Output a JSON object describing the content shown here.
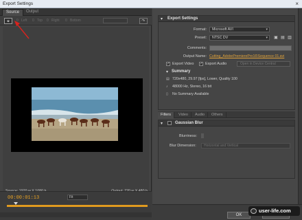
{
  "window": {
    "title": "Export Settings",
    "close_glyph": "×"
  },
  "left": {
    "tabs": [
      "Source",
      "Output"
    ],
    "toolbar": {
      "crop_glyph": "⧈",
      "fields": [
        "Left",
        "Top",
        "Right",
        "Bottom"
      ],
      "zero": "0",
      "menu_glyph": "↷"
    },
    "source_info": "Source: 1920 w X 1080 h",
    "output_info": "Output: 720 w X 480 h",
    "timecode": "00:00:01:13",
    "fit": "Fit"
  },
  "export_settings": {
    "header": "Export Settings",
    "format_label": "Format:",
    "format_value": "Microsoft AVI",
    "preset_label": "Preset:",
    "preset_value": "NTSC DV",
    "comments_label": "Comments:",
    "output_name_label": "Output Name:",
    "output_name_value": "Cutting_AdobePremierePro16\\Sequence 01.avi",
    "export_video": "Export Video",
    "export_audio": "Export Audio",
    "queue_btn": "Open in Device Central",
    "summary_header": "Summary",
    "summary_lines": [
      "720x480, 29.97 [fps], Lower, Quality 100",
      "48000 Hz, Stereo, 16 bit",
      "No Summary Available"
    ]
  },
  "filter_tabs": [
    "Filters",
    "Video",
    "Audio",
    "Others"
  ],
  "filter": {
    "title": "Gaussian Blur",
    "blurriness_label": "Blurriness:",
    "blur_dimension_label": "Blur Dimension:",
    "blur_dimension_value": "Horizontal and Vertical"
  },
  "buttons": {
    "ok": "OK",
    "cancel": "Cancel"
  },
  "watermark": "user-life.com",
  "colors": {
    "accent": "#e09a1f",
    "link": "#e0a23a"
  }
}
